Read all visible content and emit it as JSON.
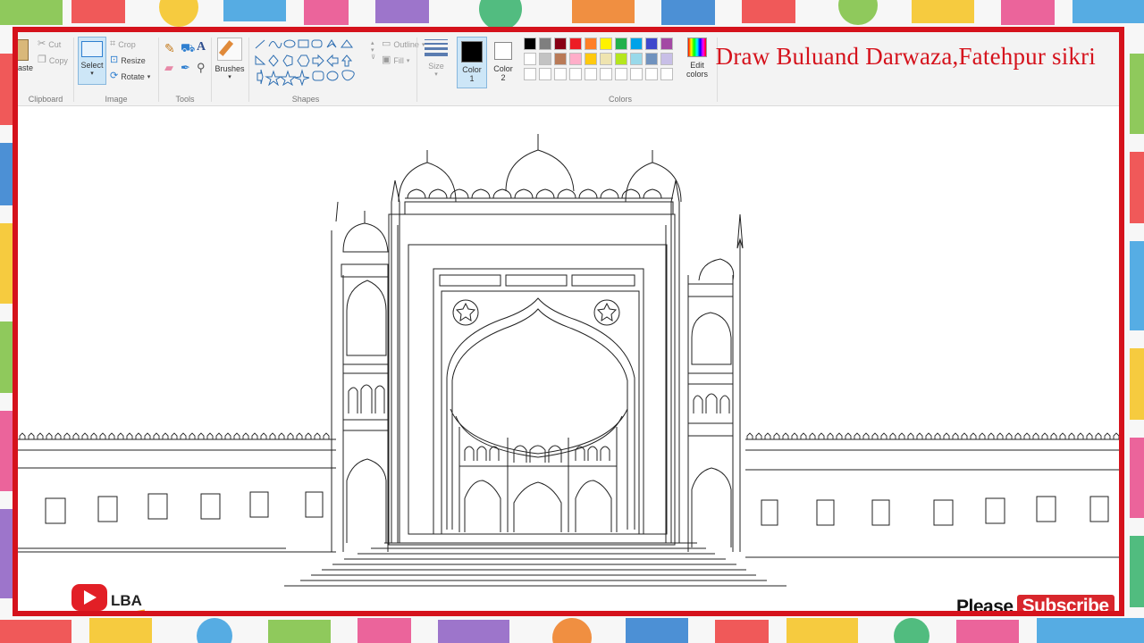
{
  "overlay_title": "Draw Buluand Darwaza,Fatehpur sikri",
  "ribbon": {
    "clipboard": {
      "paste": "Paste",
      "cut": "Cut",
      "copy": "Copy",
      "label": "Clipboard"
    },
    "image": {
      "select": "Select",
      "crop": "Crop",
      "resize": "Resize",
      "rotate": "Rotate",
      "label": "Image"
    },
    "tools": {
      "label": "Tools"
    },
    "brushes": {
      "label": "Brushes"
    },
    "shapes": {
      "outline": "Outline",
      "fill": "Fill",
      "label": "Shapes"
    },
    "size": {
      "label": "Size"
    },
    "color1": {
      "line1": "Color",
      "line2": "1"
    },
    "color2": {
      "line1": "Color",
      "line2": "2"
    },
    "colors": {
      "label": "Colors",
      "row1": [
        "#000000",
        "#7f7f7f",
        "#880015",
        "#ed1c24",
        "#ff7f27",
        "#fff200",
        "#22b14c",
        "#00a2e8",
        "#3f48cc",
        "#a349a4"
      ],
      "row2": [
        "#ffffff",
        "#c3c3c3",
        "#b97a57",
        "#ffaec9",
        "#ffc90e",
        "#efe4b0",
        "#b5e61d",
        "#99d9ea",
        "#7092be",
        "#c8bfe7"
      ]
    },
    "edit_colors": {
      "line1": "Edit",
      "line2": "colors"
    }
  },
  "logo_text": "LBA",
  "subscribe": {
    "please": "Please",
    "button": "Subscribe"
  },
  "accent_red": "#d5121c"
}
